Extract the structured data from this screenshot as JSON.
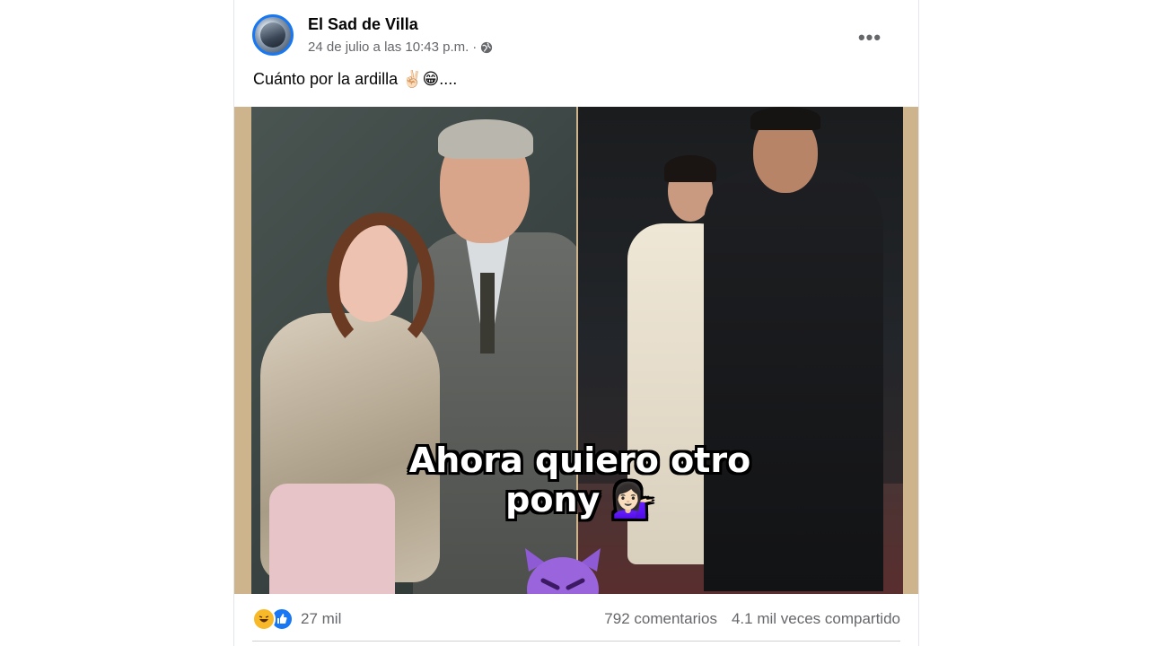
{
  "post": {
    "author": "El Sad de Villa",
    "timestamp": "24 de julio a las 10:43 p.m.",
    "separator": "·",
    "privacy_icon": "globe-icon",
    "more_label": "•••",
    "caption": "Cuánto por la ardilla ✌🏻😁....",
    "image": {
      "overlay_line1": "Ahora quiero otro",
      "overlay_line2": "pony 💁🏻‍♀️"
    }
  },
  "footer": {
    "reaction_icons": [
      "haha-icon",
      "like-icon"
    ],
    "reaction_count": "27 mil",
    "comments": "792 comentarios",
    "shares": "4.1 mil veces compartido"
  },
  "colors": {
    "accent": "#1877f2",
    "secondary_text": "#65676b",
    "frame": "#cdb48c"
  }
}
